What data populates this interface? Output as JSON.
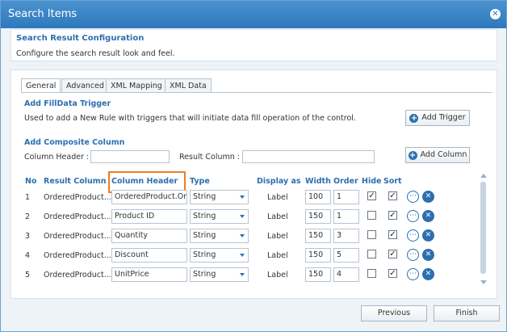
{
  "dialog": {
    "title": "Search Items",
    "close_glyph": "✕"
  },
  "config": {
    "heading": "Search Result Configuration",
    "description": "Configure the search result look and feel."
  },
  "tabs": [
    {
      "label": "General",
      "active": true
    },
    {
      "label": "Advanced",
      "active": false
    },
    {
      "label": "XML Mapping",
      "active": false
    },
    {
      "label": "XML Data",
      "active": false
    }
  ],
  "filldata": {
    "heading": "Add FillData Trigger",
    "description": "Used to add a New Rule with triggers that will initiate data fill operation of the control.",
    "button_label": "Add Trigger"
  },
  "composite": {
    "heading": "Add Composite Column",
    "column_header_label": "Column Header :",
    "column_header_value": "",
    "result_column_label": "Result Column :",
    "result_column_value": "",
    "button_label": "Add Column"
  },
  "grid": {
    "headers": {
      "no": "No",
      "result_column": "Result Column",
      "column_header": "Column Header",
      "type": "Type",
      "display_as": "Display as",
      "width": "Width",
      "order": "Order",
      "hide": "Hide",
      "sort": "Sort"
    },
    "rows": [
      {
        "no": "1",
        "result_column": "OrderedProduct...",
        "column_header": "OrderedProduct.Or",
        "type": "String",
        "display_as": "Label",
        "width": "100",
        "order": "1",
        "hide": true,
        "sort": true
      },
      {
        "no": "2",
        "result_column": "OrderedProduct...",
        "column_header": "Product ID",
        "type": "String",
        "display_as": "Label",
        "width": "150",
        "order": "1",
        "hide": false,
        "sort": true
      },
      {
        "no": "3",
        "result_column": "OrderedProduct...",
        "column_header": "Quantity",
        "type": "String",
        "display_as": "Label",
        "width": "150",
        "order": "3",
        "hide": false,
        "sort": true
      },
      {
        "no": "4",
        "result_column": "OrderedProduct...",
        "column_header": "Discount",
        "type": "String",
        "display_as": "Label",
        "width": "150",
        "order": "5",
        "hide": false,
        "sort": true
      },
      {
        "no": "5",
        "result_column": "OrderedProduct...",
        "column_header": "UnitPrice",
        "type": "String",
        "display_as": "Label",
        "width": "150",
        "order": "4",
        "hide": false,
        "sort": true
      }
    ]
  },
  "icons": {
    "more": "more-options-icon",
    "settings": "tools-icon",
    "add": "plus-circle-icon"
  },
  "colors": {
    "titlebar": "#2e78bd",
    "accent": "#2d6fb0",
    "highlight": "#f07c22"
  },
  "footer": {
    "previous_label": "Previous",
    "finish_label": "Finish"
  }
}
